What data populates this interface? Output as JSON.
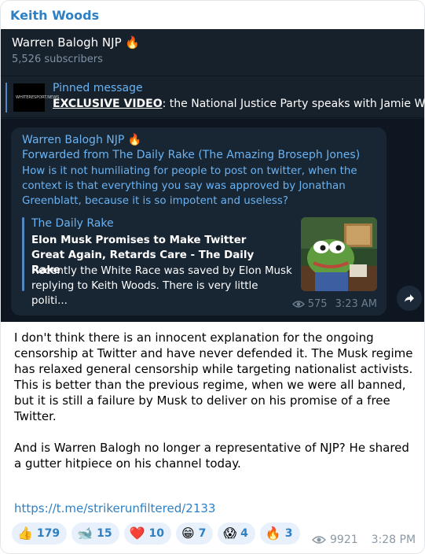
{
  "post": {
    "author": "Keith Woods",
    "body_paragraphs": [
      "I don't think there is an innocent explanation for the ongoing censorship at Twitter and have never defended it. The Musk regime has relaxed general censorship while targeting nationalist activists. This is better than the previous regime, when we were all banned, but it is still a failure by Musk to deliver on his promise of a free Twitter.",
      "And is Warren Balogh no longer a representative of NJP? He shared a gutter hitpiece on his channel today."
    ],
    "link": "https://t.me/strikerunfiltered/2133",
    "reactions": [
      {
        "emoji": "👍",
        "count": "179"
      },
      {
        "emoji": "🐋",
        "count": "15"
      },
      {
        "emoji": "❤️",
        "count": "10"
      },
      {
        "emoji": "😁",
        "count": "7"
      },
      {
        "emoji": "😱",
        "count": "4"
      },
      {
        "emoji": "🔥",
        "count": "3"
      }
    ],
    "views": "9921",
    "time": "3:28 PM"
  },
  "embed": {
    "channel_title": "Warren Balogh NJP 🔥",
    "subscribers": "5,526 subscribers",
    "pinned": {
      "label": "Pinned message",
      "thumb_text": "WHITERESPORT.NEWS",
      "bold_text": "EXCLUSIVE VIDEO",
      "text": ": the National Justice Party speaks with Jamie White, 'h"
    },
    "message": {
      "sender": "Warren Balogh NJP 🔥",
      "forwarded": "Forwarded from The Daily Rake (The Amazing Broseph Jones)",
      "text": "How is it not humiliating for people to post on twitter, when the context is that everything you say was approved by Jonathan Greenblatt, because it is so impotent and useless?",
      "preview": {
        "site": "The Daily Rake",
        "title": "Elon Musk Promises to Make Twitter Great Again, Retards Care - The Daily Rake",
        "description": "Recently the White Race was saved by Elon Musk replying to Keith Woods. There is very little politi..."
      },
      "views": "575",
      "time": "3:23 AM"
    }
  },
  "colors": {
    "accent": "#2f80c3",
    "dark_bg": "#17212b",
    "chat_bg": "#0e1621",
    "bubble": "#182533",
    "telegram_blue": "#6ab3f3"
  },
  "icons": {
    "eye": "eye-icon",
    "share": "share-arrow-icon",
    "preview_image": "frog-illustration"
  }
}
